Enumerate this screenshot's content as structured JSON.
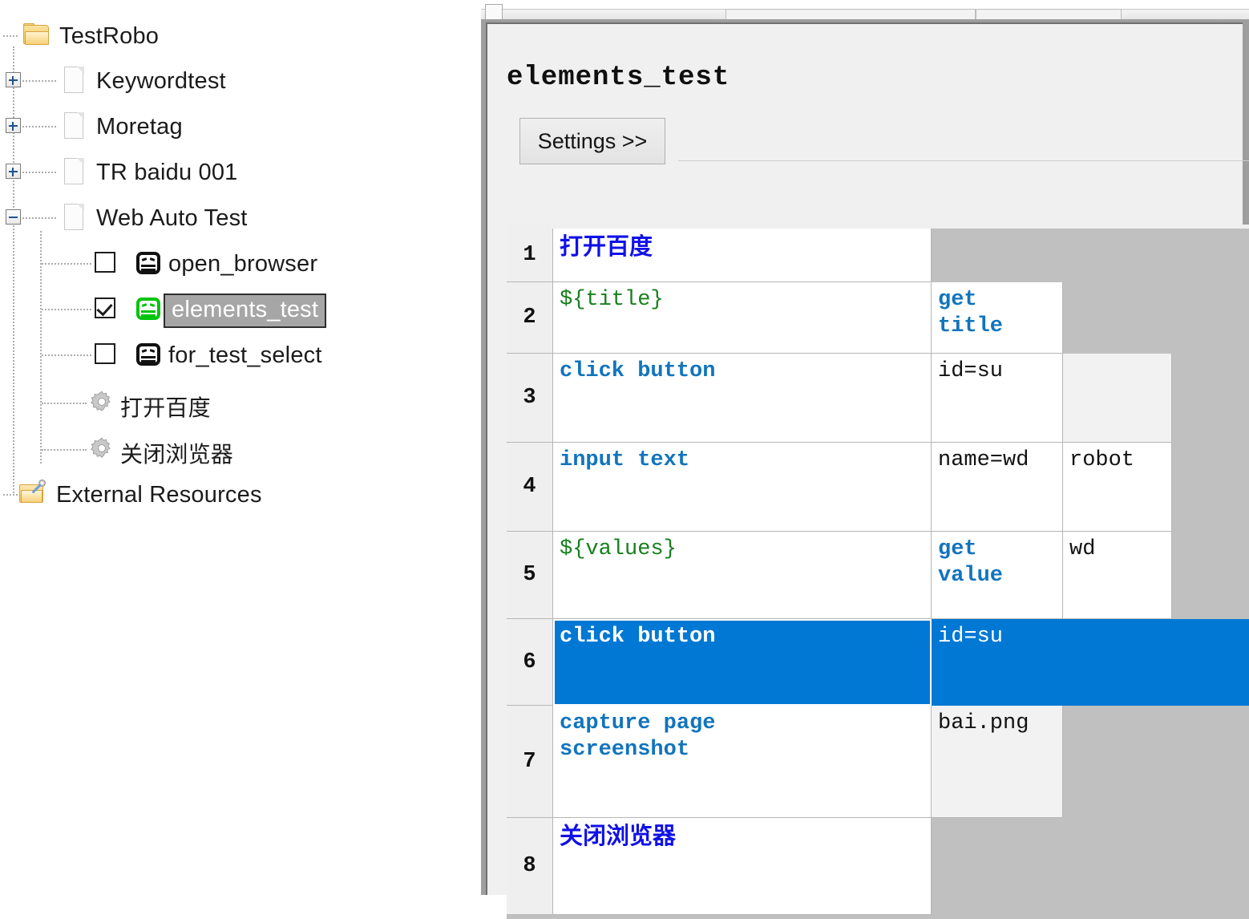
{
  "tree": {
    "items": [
      {
        "label": "TestRobo",
        "icon": "folder-icon",
        "indent": 0,
        "expander": null,
        "checkbox": null
      },
      {
        "label": "Keywordtest",
        "icon": "document-icon",
        "indent": 1,
        "expander": "plus",
        "checkbox": null
      },
      {
        "label": "Moretag",
        "icon": "document-icon",
        "indent": 1,
        "expander": "plus",
        "checkbox": null
      },
      {
        "label": "TR baidu 001",
        "icon": "document-icon",
        "indent": 1,
        "expander": "plus",
        "checkbox": null
      },
      {
        "label": "Web Auto Test",
        "icon": "document-icon",
        "indent": 1,
        "expander": "minus",
        "checkbox": null
      },
      {
        "label": "open_browser",
        "icon": "robot-icon",
        "indent": 2,
        "expander": null,
        "checkbox": "unchecked"
      },
      {
        "label": "elements_test",
        "icon": "robot-icon-green",
        "indent": 2,
        "expander": null,
        "checkbox": "checked",
        "selected": true
      },
      {
        "label": "for_test_select",
        "icon": "robot-icon",
        "indent": 2,
        "expander": null,
        "checkbox": "unchecked"
      },
      {
        "label": "打开百度",
        "icon": "gear-icon",
        "indent": 2,
        "expander": null,
        "checkbox": null
      },
      {
        "label": "关闭浏览器",
        "icon": "gear-icon",
        "indent": 2,
        "expander": null,
        "checkbox": null
      },
      {
        "label": "External Resources",
        "icon": "resources-folder-icon",
        "indent": 0,
        "expander": null,
        "checkbox": null
      }
    ]
  },
  "editor": {
    "suite_title": "elements_test",
    "settings_button": "Settings >>",
    "grid": {
      "rows": [
        {
          "num": "1",
          "cells": [
            {
              "text": "打开百度",
              "style": "kwcn"
            },
            {
              "text": "",
              "style": "none"
            },
            {
              "text": "",
              "style": "none"
            },
            {
              "text": "",
              "style": "none"
            },
            {
              "text": "",
              "style": "none"
            },
            {
              "text": "",
              "style": "none"
            }
          ]
        },
        {
          "num": "2",
          "cells": [
            {
              "text": "${title}",
              "style": "var"
            },
            {
              "text": "get\ntitle",
              "style": "kw"
            },
            {
              "text": "",
              "style": "none"
            },
            {
              "text": "",
              "style": "none"
            },
            {
              "text": "",
              "style": "none"
            },
            {
              "text": "",
              "style": "none"
            }
          ]
        },
        {
          "num": "3",
          "cells": [
            {
              "text": "click button",
              "style": "kw"
            },
            {
              "text": "id=su",
              "style": "arg"
            },
            {
              "text": "",
              "style": "shade"
            },
            {
              "text": "",
              "style": "none"
            },
            {
              "text": "",
              "style": "none"
            },
            {
              "text": "",
              "style": "none"
            }
          ]
        },
        {
          "num": "4",
          "cells": [
            {
              "text": "input text",
              "style": "kw"
            },
            {
              "text": "name=wd",
              "style": "arg"
            },
            {
              "text": "robot",
              "style": "arg"
            },
            {
              "text": "",
              "style": "none"
            },
            {
              "text": "",
              "style": "none"
            },
            {
              "text": "",
              "style": "none"
            }
          ]
        },
        {
          "num": "5",
          "cells": [
            {
              "text": "${values}",
              "style": "var"
            },
            {
              "text": "get\nvalue",
              "style": "kw"
            },
            {
              "text": "wd",
              "style": "arg"
            },
            {
              "text": "",
              "style": "none"
            },
            {
              "text": "",
              "style": "none"
            },
            {
              "text": "",
              "style": "none"
            }
          ]
        },
        {
          "num": "6",
          "selected": true,
          "cells": [
            {
              "text": "click button",
              "style": "kw",
              "active": true
            },
            {
              "text": "id=su",
              "style": "arg"
            },
            {
              "text": "",
              "style": "blank"
            },
            {
              "text": "",
              "style": "blank"
            },
            {
              "text": "",
              "style": "blank"
            },
            {
              "text": "",
              "style": "blank"
            }
          ]
        },
        {
          "num": "7",
          "cells": [
            {
              "text": "capture page\nscreenshot",
              "style": "kw"
            },
            {
              "text": "bai.png",
              "style": "arg shade"
            },
            {
              "text": "",
              "style": "none"
            },
            {
              "text": "",
              "style": "none"
            },
            {
              "text": "",
              "style": "none"
            },
            {
              "text": "",
              "style": "none"
            }
          ]
        },
        {
          "num": "8",
          "cells": [
            {
              "text": "关闭浏览器",
              "style": "kwcn"
            },
            {
              "text": "",
              "style": "none"
            },
            {
              "text": "",
              "style": "none"
            },
            {
              "text": "",
              "style": "none"
            },
            {
              "text": "",
              "style": "none"
            },
            {
              "text": "",
              "style": "none"
            }
          ]
        }
      ]
    }
  },
  "colors": {
    "selection_blue": "#0078d4",
    "keyword_blue": "#1274bd",
    "cjk_keyword_blue": "#1010e8",
    "variable_green": "#17801d",
    "grid_background_gray": "#c0c0c0",
    "tree_selection_gray": "#a6a6a6",
    "robot_green": "#00c40c"
  }
}
